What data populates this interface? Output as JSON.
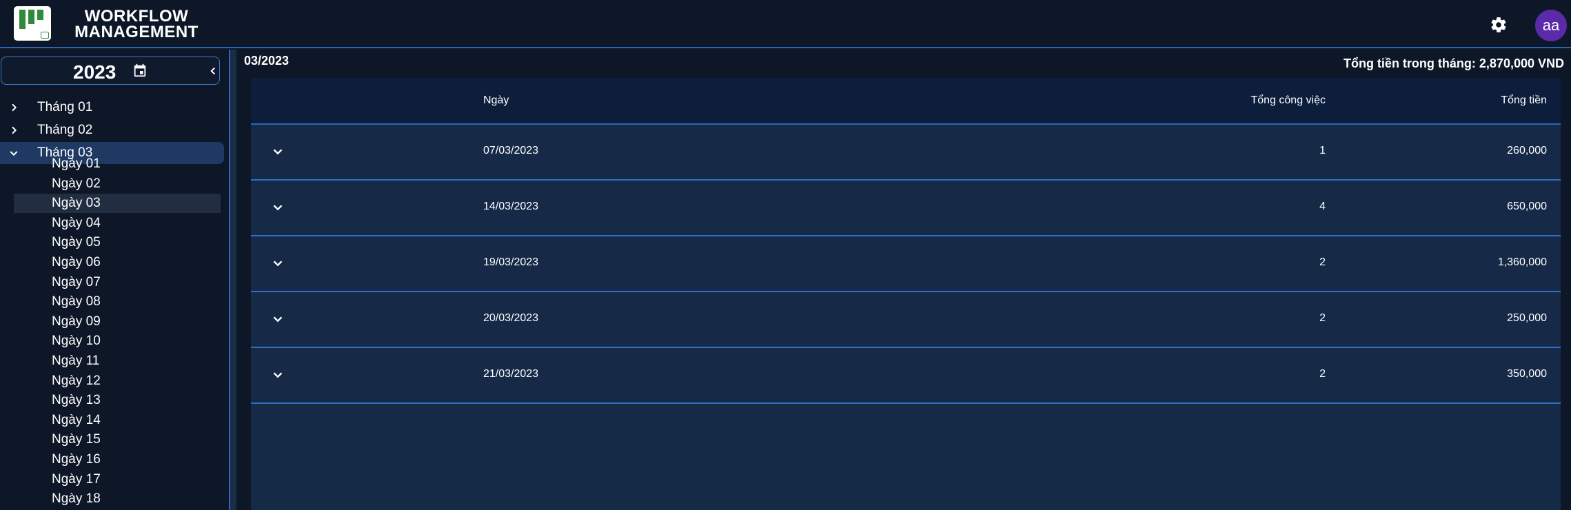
{
  "header": {
    "brand_line1": "WORKFLOW",
    "brand_line2": "MANAGEMENT",
    "logo_icon": "kanban-logo-icon",
    "settings_icon": "gear-icon",
    "avatar_initials": "aa"
  },
  "sidebar": {
    "year": "2023",
    "year_icon": "calendar-icon",
    "collapse_icon": "chevron-left-icon",
    "months": [
      {
        "label": "Tháng 01",
        "expanded": false
      },
      {
        "label": "Tháng 02",
        "expanded": false
      },
      {
        "label": "Tháng 03",
        "expanded": true
      }
    ],
    "days": [
      "Ngày 01",
      "Ngày 02",
      "Ngày 03",
      "Ngày 04",
      "Ngày 05",
      "Ngày 06",
      "Ngày 07",
      "Ngày 08",
      "Ngày 09",
      "Ngày 10",
      "Ngày 11",
      "Ngày 12",
      "Ngày 13",
      "Ngày 14",
      "Ngày 15",
      "Ngày 16",
      "Ngày 17",
      "Ngày 18"
    ],
    "selected_day": "Ngày 03"
  },
  "main": {
    "period": "03/2023",
    "total_label": "Tổng tiền trong tháng: 2,870,000 VND",
    "columns": {
      "date": "Ngày",
      "count": "Tổng công việc",
      "amount": "Tổng tiền"
    },
    "rows": [
      {
        "date": "07/03/2023",
        "count": "1",
        "amount": "260,000"
      },
      {
        "date": "14/03/2023",
        "count": "4",
        "amount": "650,000"
      },
      {
        "date": "19/03/2023",
        "count": "2",
        "amount": "1,360,000"
      },
      {
        "date": "20/03/2023",
        "count": "2",
        "amount": "250,000"
      },
      {
        "date": "21/03/2023",
        "count": "2",
        "amount": "350,000"
      }
    ]
  },
  "colors": {
    "background": "#0d1727",
    "accent_border": "#2b67b6",
    "row_bg": "#162a48",
    "header_bg": "#0c1e3c",
    "active_month_bg": "#1e3a62",
    "avatar_bg": "#5a2aa8",
    "logo_green": "#2f8a39"
  }
}
